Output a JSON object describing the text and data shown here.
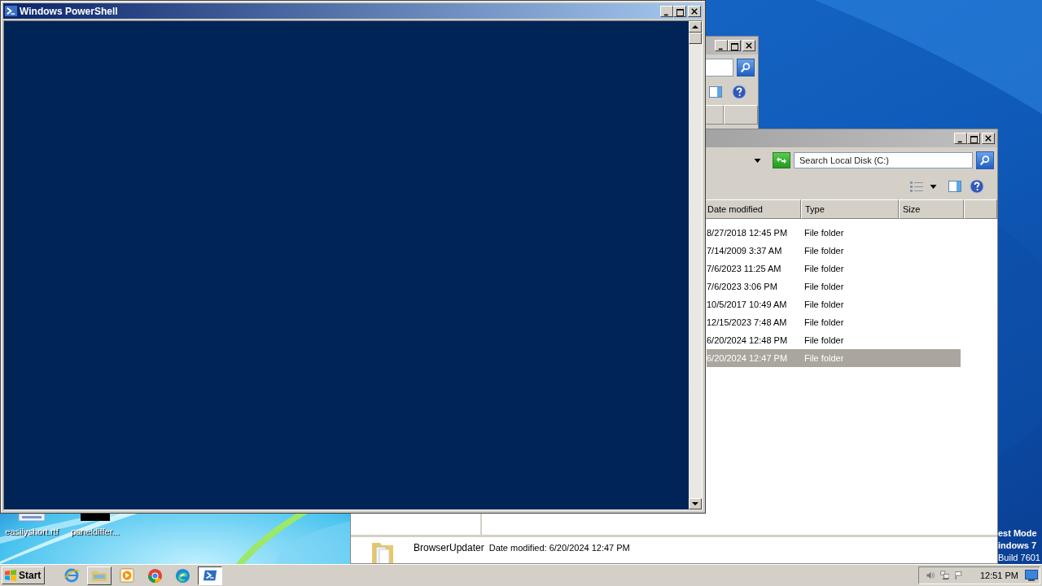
{
  "powershell": {
    "title": "Windows PowerShell"
  },
  "explorer_window": {
    "search": {
      "placeholder": "Search Local Disk (C:)"
    },
    "columns": [
      "Date modified",
      "Type",
      "Size"
    ],
    "rows": [
      {
        "date_modified": "8/27/2018 12:45 PM",
        "type": "File folder",
        "selected": false
      },
      {
        "date_modified": "7/14/2009 3:37 AM",
        "type": "File folder",
        "selected": false
      },
      {
        "date_modified": "7/6/2023 11:25 AM",
        "type": "File folder",
        "selected": false
      },
      {
        "date_modified": "7/6/2023 3:06 PM",
        "type": "File folder",
        "selected": false
      },
      {
        "date_modified": "10/5/2017 10:49 AM",
        "type": "File folder",
        "selected": false
      },
      {
        "date_modified": "12/15/2023 7:48 AM",
        "type": "File folder",
        "selected": false
      },
      {
        "date_modified": "6/20/2024 12:48 PM",
        "type": "File folder",
        "selected": false
      },
      {
        "date_modified": "6/20/2024 12:47 PM",
        "type": "File folder",
        "selected": true
      }
    ],
    "details": {
      "name": "BrowserUpdater",
      "date_modified": "Date modified: 6/20/2024 12:47 PM"
    }
  },
  "desktop": {
    "icons": [
      {
        "label": "easilyshort.rtf",
        "kind": "document"
      },
      {
        "label": "paneldiffer...",
        "kind": "black"
      }
    ],
    "test_mode": [
      "est Mode",
      "indows 7",
      "Build 7601"
    ]
  },
  "taskbar": {
    "start_label": "Start",
    "apps": [
      {
        "kind": "ie",
        "running": false,
        "selected": false
      },
      {
        "kind": "explorer",
        "running": true,
        "selected": false
      },
      {
        "kind": "media",
        "running": false,
        "selected": false
      },
      {
        "kind": "chrome",
        "running": false,
        "selected": false
      },
      {
        "kind": "edge",
        "running": false,
        "selected": false
      },
      {
        "kind": "powershell",
        "running": true,
        "selected": true
      }
    ],
    "clock": "12:51 PM"
  }
}
